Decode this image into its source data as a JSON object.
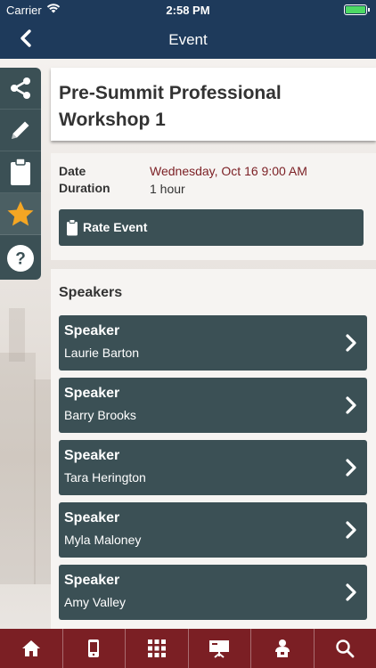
{
  "status_bar": {
    "carrier": "Carrier",
    "time": "2:58 PM"
  },
  "nav": {
    "title": "Event",
    "back_icon": "chevron-left-icon"
  },
  "sidebar": {
    "items": [
      {
        "icon": "share-icon"
      },
      {
        "icon": "pencil-icon"
      },
      {
        "icon": "clipboard-icon"
      },
      {
        "icon": "star-icon"
      },
      {
        "icon": "help-icon"
      }
    ]
  },
  "event": {
    "title": "Pre-Summit Professional Workshop 1",
    "date_label": "Date",
    "date_value": "Wednesday, Oct 16 9:00 AM",
    "duration_label": "Duration",
    "duration_value": "1 hour",
    "rate_button": "Rate Event"
  },
  "speakers": {
    "heading": "Speakers",
    "items": [
      {
        "role": "Speaker",
        "name": "Laurie Barton"
      },
      {
        "role": "Speaker",
        "name": "Barry Brooks"
      },
      {
        "role": "Speaker",
        "name": "Tara Herington"
      },
      {
        "role": "Speaker",
        "name": "Myla Maloney"
      },
      {
        "role": "Speaker",
        "name": "Amy Valley"
      }
    ]
  },
  "tabbar": {
    "tabs": [
      {
        "icon": "home-icon"
      },
      {
        "icon": "mobile-icon"
      },
      {
        "icon": "grid-icon"
      },
      {
        "icon": "presentation-icon"
      },
      {
        "icon": "speaker-icon"
      },
      {
        "icon": "search-icon"
      }
    ]
  },
  "colors": {
    "nav_bg": "#1e3a5b",
    "panel_button": "#3b5055",
    "tabbar_bg": "#7b1f24",
    "date_text": "#7b1f24",
    "star": "#f5a623",
    "battery": "#4cd964"
  }
}
